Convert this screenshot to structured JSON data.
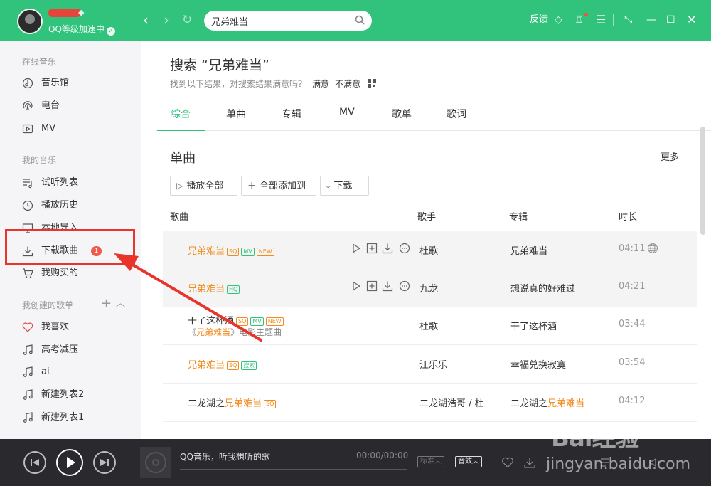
{
  "header": {
    "user_level": "QQ等级加速中",
    "level_check": "✓",
    "search_value": "兄弟难当",
    "feedback": "反馈",
    "icons": [
      "back-icon",
      "forward-icon",
      "refresh-icon",
      "search-icon",
      "diamond-icon",
      "skin-icon",
      "menu-icon",
      "mini-mode-icon",
      "minimize-icon",
      "maximize-icon",
      "close-icon"
    ]
  },
  "sidebar": {
    "online_header": "在线音乐",
    "online_items": [
      {
        "label": "音乐馆",
        "icon": "music-hall-icon"
      },
      {
        "label": "电台",
        "icon": "radio-icon"
      },
      {
        "label": "MV",
        "icon": "mv-icon"
      }
    ],
    "my_header": "我的音乐",
    "my_items": [
      {
        "label": "试听列表",
        "icon": "playlist-icon"
      },
      {
        "label": "播放历史",
        "icon": "clock-icon"
      },
      {
        "label": "本地导入",
        "icon": "monitor-icon"
      },
      {
        "label": "下载歌曲",
        "icon": "download-icon",
        "badge": "1"
      },
      {
        "label": "我购买的",
        "icon": "cart-icon"
      }
    ],
    "created_header": "我创建的歌单",
    "created_items": [
      {
        "label": "我喜欢",
        "icon": "heart-icon"
      },
      {
        "label": "高考减压",
        "icon": "note-icon"
      },
      {
        "label": "ai",
        "icon": "note-icon"
      },
      {
        "label": "新建列表2",
        "icon": "note-icon"
      },
      {
        "label": "新建列表1",
        "icon": "note-icon"
      }
    ]
  },
  "main": {
    "search_title": "搜索 “兄弟难当”",
    "hint_text": "找到以下结果，对搜索结果满意吗？",
    "satisfied": "满意",
    "not_satisfied": "不满意",
    "tabs": [
      "综合",
      "单曲",
      "专辑",
      "MV",
      "歌单",
      "歌词"
    ],
    "active_tab": 0,
    "section_title": "单曲",
    "more": "更多",
    "buttons": {
      "play_all": "播放全部",
      "add_all": "全部添加到",
      "download": "下载"
    },
    "columns": {
      "song": "歌曲",
      "singer": "歌手",
      "album": "专辑",
      "duration": "时长"
    },
    "rows": [
      {
        "name": "兄弟难当",
        "tags": [
          "SQ",
          "MV",
          "NEW"
        ],
        "singer": "杜歌",
        "album": "兄弟难当",
        "duration": "04:11"
      },
      {
        "name": "兄弟难当",
        "tags": [
          "HQ"
        ],
        "singer": "九龙",
        "album": "想说真的好难过",
        "duration": "04:21"
      },
      {
        "name": "干了这杯酒",
        "tags": [
          "SQ",
          "MV",
          "NEW"
        ],
        "sub_pre": "《",
        "sub_hl": "兄弟难当",
        "sub_post": "》电影主题曲",
        "singer": "杜歌",
        "album": "干了这杯酒",
        "duration": "03:44"
      },
      {
        "name": "兄弟难当",
        "tags": [
          "SQ",
          "搜索"
        ],
        "singer": "江乐乐",
        "album": "幸福兑换寂寞",
        "duration": "03:54"
      },
      {
        "name_pre": "二龙湖之",
        "name_hl": "兄弟难当",
        "tags": [
          "SQ"
        ],
        "singer": "二龙湖浩哥 / 杜",
        "album_pre": "二龙湖之",
        "album_hl": "兄弟难当",
        "duration": "04:12"
      }
    ]
  },
  "player": {
    "now_playing": "QQ音乐，听我想听的歌",
    "time": "00:00/00:00",
    "quality": "标准",
    "effect": "音效"
  },
  "watermark": {
    "logo": "Bai经验",
    "url": "jingyan.baidu.com"
  },
  "colors": {
    "brand": "#31c27c",
    "highlight": "#f28b1d",
    "annotation": "#e8342a"
  }
}
